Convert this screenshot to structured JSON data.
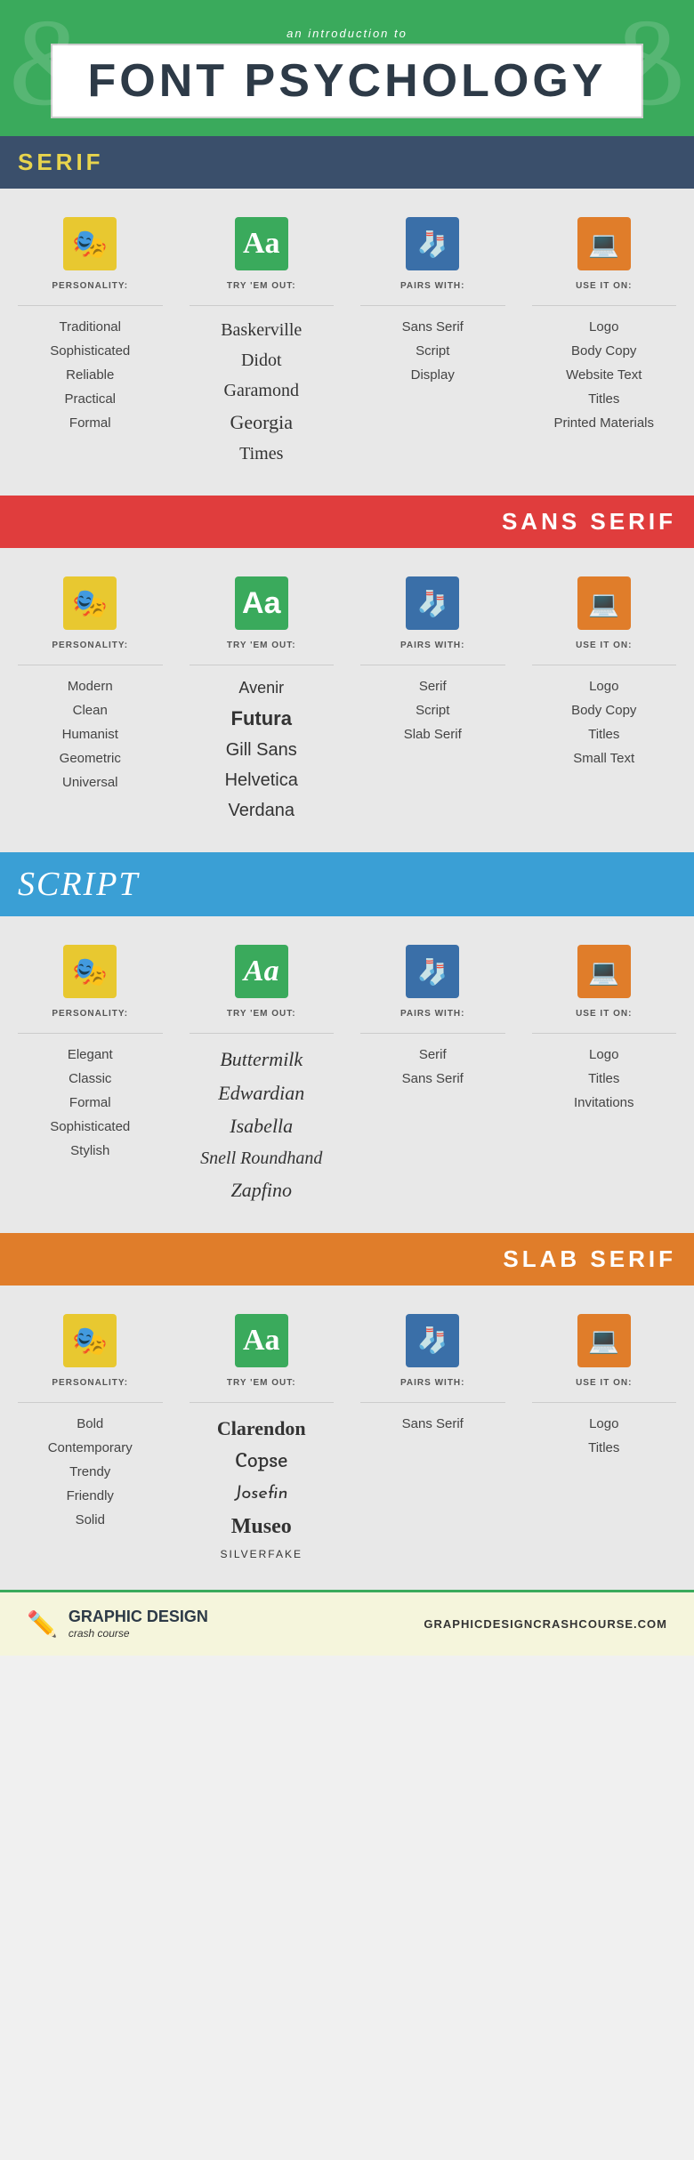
{
  "header": {
    "subtitle": "an introduction to",
    "title": "FONT PSYCHOLOGY"
  },
  "sections": [
    {
      "id": "serif",
      "label": "SERIF",
      "headerClass": "serif-header",
      "personality": [
        "Traditional",
        "Sophisticated",
        "Reliable",
        "Practical",
        "Formal"
      ],
      "try_em_out": [
        "Baskerville",
        "Didot",
        "Garamond",
        "Georgia",
        "Times"
      ],
      "pairs_with": [
        "Sans Serif",
        "Script",
        "Display"
      ],
      "use_it_on": [
        "Logo",
        "Body Copy",
        "Website Text",
        "Titles",
        "Printed Materials"
      ]
    },
    {
      "id": "sans-serif",
      "label": "SANS SERIF",
      "headerClass": "sansserif-header",
      "personality": [
        "Modern",
        "Clean",
        "Humanist",
        "Geometric",
        "Universal"
      ],
      "try_em_out": [
        "Avenir",
        "Futura",
        "Gill Sans",
        "Helvetica",
        "Verdana"
      ],
      "pairs_with": [
        "Serif",
        "Script",
        "Slab Serif"
      ],
      "use_it_on": [
        "Logo",
        "Body Copy",
        "Titles",
        "Small Text"
      ]
    },
    {
      "id": "script",
      "label": "script",
      "headerClass": "script-header",
      "personality": [
        "Elegant",
        "Classic",
        "Formal",
        "Sophisticated",
        "Stylish"
      ],
      "try_em_out": [
        "Buttermilk",
        "Edwardian",
        "Isabella",
        "Snell Roundhand",
        "Zapfino"
      ],
      "pairs_with": [
        "Serif",
        "Sans Serif"
      ],
      "use_it_on": [
        "Logo",
        "Titles",
        "Invitations"
      ]
    },
    {
      "id": "slab-serif",
      "label": "SLAB SERIF",
      "headerClass": "slabserif-header",
      "personality": [
        "Bold",
        "Contemporary",
        "Trendy",
        "Friendly",
        "Solid"
      ],
      "try_em_out": [
        "Clarendon",
        "Copse",
        "Josefin",
        "Museo",
        "SILVERFAKE"
      ],
      "pairs_with": [
        "Sans Serif"
      ],
      "use_it_on": [
        "Logo",
        "Titles"
      ]
    }
  ],
  "footer": {
    "brand_name": "GRAPHIC DESIGN",
    "brand_sub": "crash course",
    "url": "GRAPHICDESIGNCRASHCOURSE.COM"
  }
}
